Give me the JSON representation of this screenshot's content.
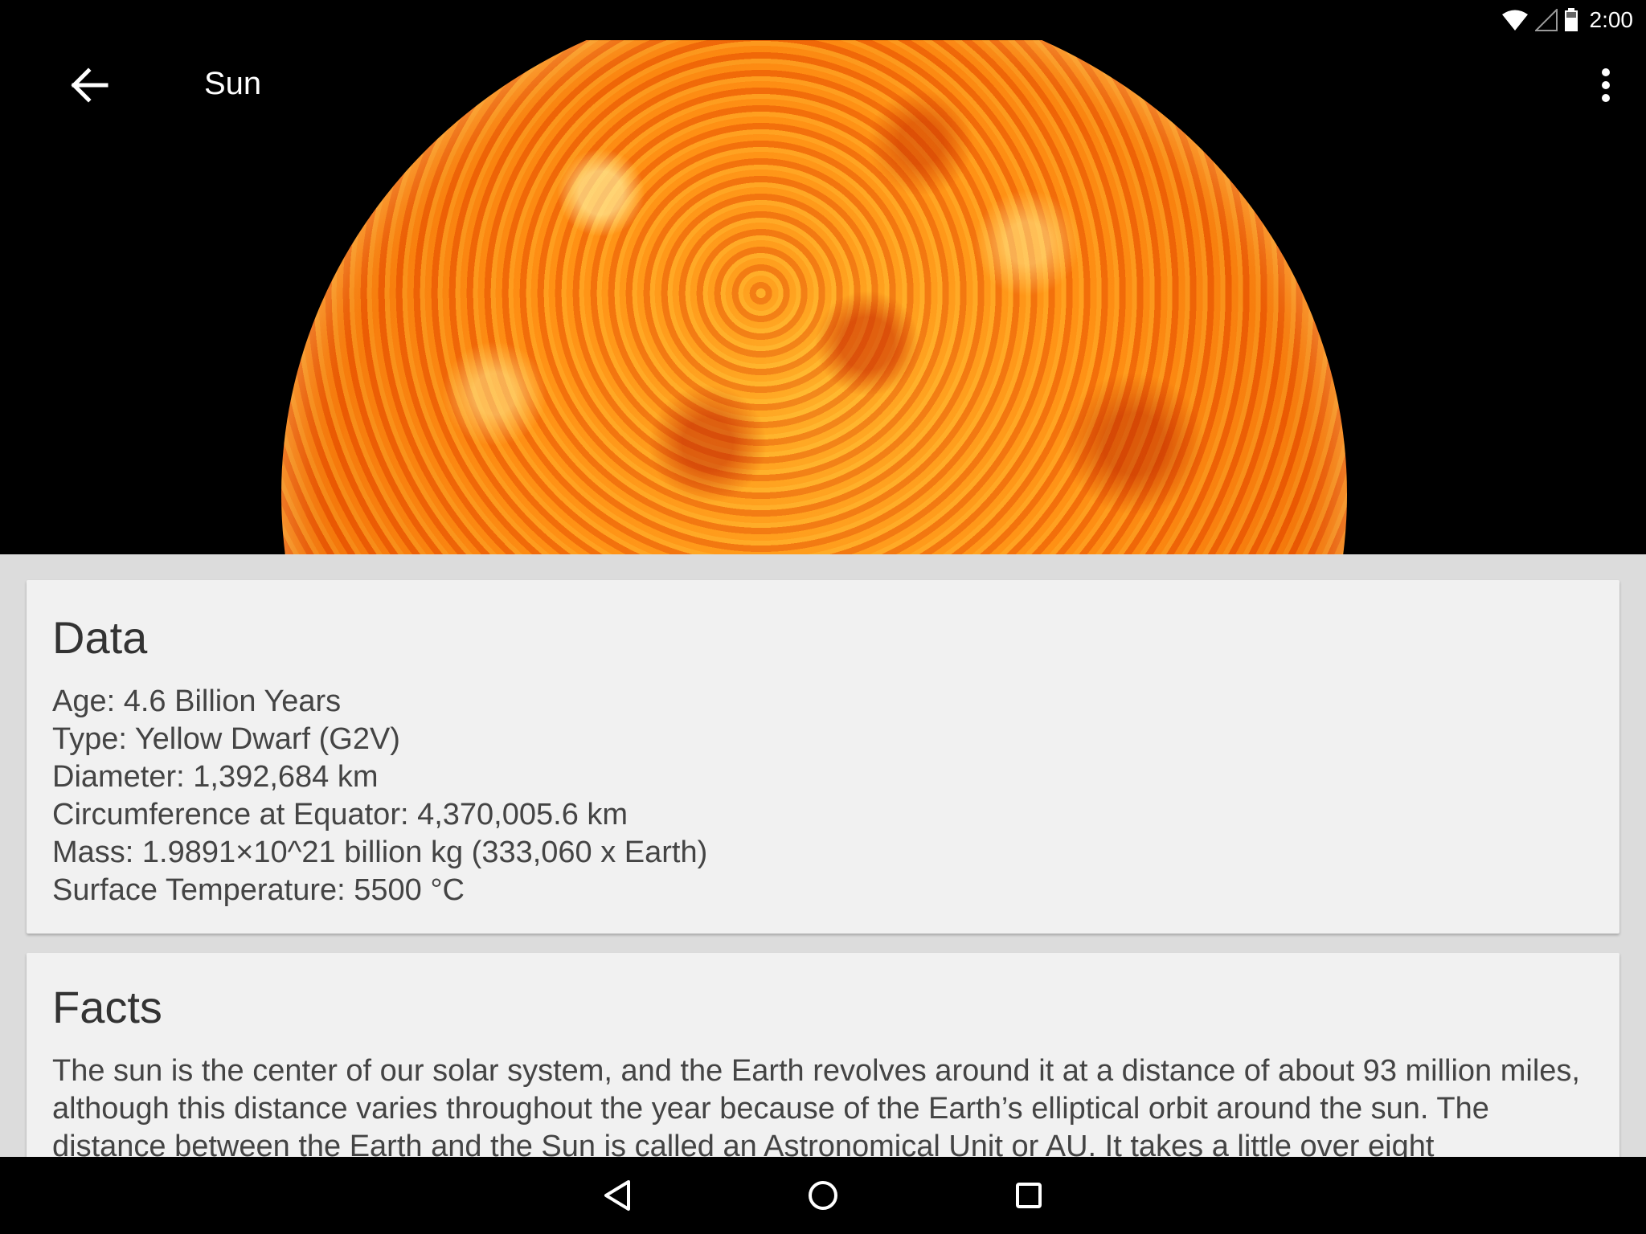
{
  "status_bar": {
    "time": "2:00",
    "icons": [
      "wifi-icon",
      "cell-signal-icon",
      "battery-icon"
    ]
  },
  "toolbar": {
    "title": "Sun",
    "back_icon": "arrow-back-icon",
    "overflow_icon": "more-vert-icon"
  },
  "hero": {
    "image": "sun-image"
  },
  "data_card": {
    "title": "Data",
    "lines": [
      "Age: 4.6 Billion Years",
      "Type: Yellow Dwarf (G2V)",
      "Diameter: 1,392,684 km",
      "Circumference at Equator: 4,370,005.6 km",
      "Mass: 1.9891×10^21 billion kg (333,060 x Earth)",
      "Surface Temperature: 5500 °C"
    ]
  },
  "facts_card": {
    "title": "Facts",
    "text": "The sun is the center of our solar system, and the Earth revolves around it at a distance of about 93 million miles, although this distance varies throughout the year because of the Earth’s elliptical orbit around the sun. The distance between the Earth and the Sun is called an Astronomical Unit or AU. It takes a little over eight"
  },
  "nav_bar": {
    "buttons": [
      "nav-back-icon",
      "nav-home-icon",
      "nav-recents-icon"
    ]
  },
  "colors": {
    "status_bar": "#000000",
    "hero_background": "#000000",
    "page_background": "#dcdcdc",
    "card_background": "#f1f1f1",
    "title_text": "#333333",
    "body_text": "#444444",
    "toolbar_text": "#ffffff"
  }
}
